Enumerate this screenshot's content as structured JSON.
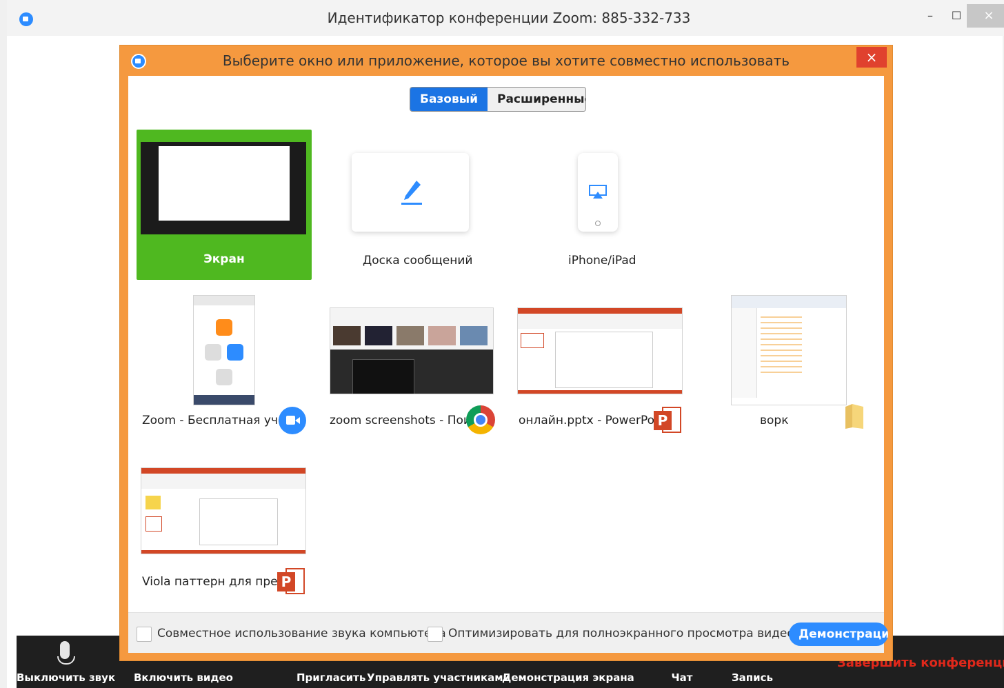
{
  "window": {
    "title": "Идентификатор конференции Zoom: 885-332-733",
    "min_glyph": "–",
    "max_glyph": "☐",
    "close_glyph": "×"
  },
  "dialog": {
    "title": "Выберите окно или приложение, которое вы хотите совместно использовать",
    "close_glyph": "×",
    "tabs": [
      "Базовый",
      "Расширенные"
    ],
    "tiles": {
      "screen": "Экран",
      "whiteboard": "Доска сообщений",
      "iphone": "iPhone/iPad"
    },
    "windows": [
      {
        "label": "Zoom - Бесплатная уче...",
        "icon": "zoom-app-icon"
      },
      {
        "label": "zoom screenshots - Пои...",
        "icon": "chrome-icon"
      },
      {
        "label": "онлайн.pptx - PowerPoi...",
        "icon": "powerpoint-icon"
      },
      {
        "label": "ворк",
        "icon": "folder-icon"
      },
      {
        "label": "Viola паттерн для презе...",
        "icon": "powerpoint-icon"
      }
    ],
    "ppt_letter": "P",
    "footer": {
      "share_sound": "Совместное использование звука компьютера",
      "optimize_video": "Оптимизировать для полноэкранного просмотра видеоролика",
      "share_button": "Демонстрация"
    }
  },
  "toolbar": {
    "mute": "Выключить звук",
    "video": "Включить видео",
    "invite": "Пригласить",
    "participants": "Управлять участниками",
    "share_screen": "Демонстрация экрана",
    "chat": "Чат",
    "record": "Запись",
    "end": "Завершить конференцию"
  },
  "colors": {
    "dialog_frame": "#f5993f",
    "screen_selected": "#4fb820",
    "zoom_blue": "#2d8cff",
    "end_red": "#e0281b"
  }
}
